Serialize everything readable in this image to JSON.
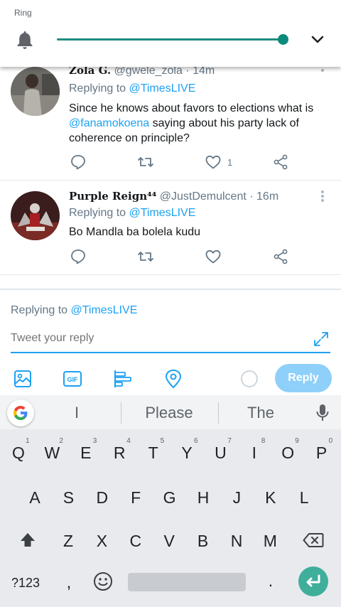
{
  "volume_panel": {
    "label": "Ring",
    "level_percent": 100,
    "accent_color": "#0e8a7c"
  },
  "tweets": [
    {
      "display_name": "Zola G.",
      "handle": "@gwele_zola",
      "time": "· 14m",
      "replying_prefix": "Replying to ",
      "replying_to": "@TimesLIVE",
      "text_mention": "@fanamokoena",
      "text_line1": "Since he knows about favors to elections what is",
      "text_rest": " saying about his party lack of coherence on principle?",
      "like_count": "1"
    },
    {
      "display_name": "Purple Reign⁴⁴",
      "handle": "@JustDemulcent",
      "time": "· 16m",
      "replying_prefix": "Replying to ",
      "replying_to": "@TimesLIVE",
      "text": "Bo Mandla ba bolela kudu",
      "like_count": ""
    }
  ],
  "composer": {
    "replying_prefix": "Replying to ",
    "replying_to": "@TimesLIVE",
    "placeholder": "Tweet your reply",
    "reply_label": "Reply",
    "accent_color": "#1da1f2"
  },
  "keyboard": {
    "suggestions": [
      "I",
      "Please",
      "The"
    ],
    "row1": [
      "Q",
      "W",
      "E",
      "R",
      "T",
      "Y",
      "U",
      "I",
      "O",
      "P"
    ],
    "row1_hints": [
      "1",
      "2",
      "3",
      "4",
      "5",
      "6",
      "7",
      "8",
      "9",
      "0"
    ],
    "row2": [
      "A",
      "S",
      "D",
      "F",
      "G",
      "H",
      "J",
      "K",
      "L"
    ],
    "row3": [
      "Z",
      "X",
      "C",
      "V",
      "B",
      "N",
      "M"
    ],
    "symbols_label": "?123",
    "comma": ",",
    "period": "."
  }
}
